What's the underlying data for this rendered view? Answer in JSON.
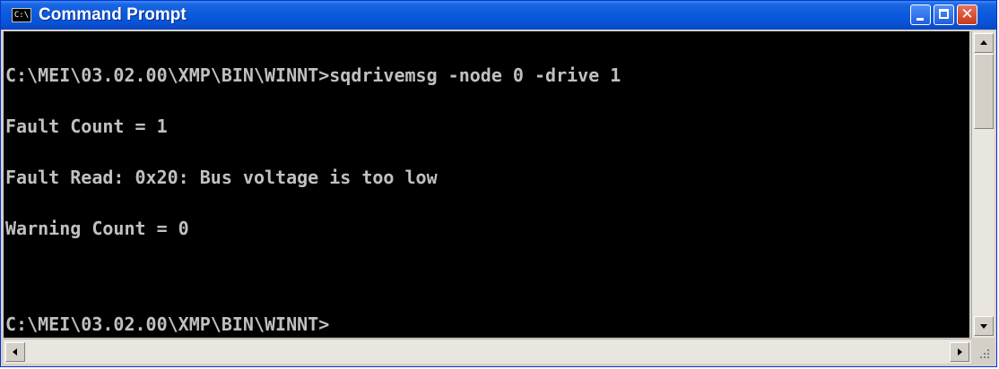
{
  "window": {
    "title": "Command Prompt",
    "icon": "console-app-icon",
    "icon_text": "C:\\",
    "controls": {
      "minimize_icon": "minimize-icon",
      "maximize_icon": "maximize-icon",
      "close_icon": "close-icon",
      "close_glyph": "✕"
    }
  },
  "console": {
    "lines": [
      "C:\\MEI\\03.02.00\\XMP\\BIN\\WINNT>sqdrivemsg -node 0 -drive 1",
      "Fault Count = 1",
      "Fault Read: 0x20: Bus voltage is too low",
      "Warning Count = 0",
      "",
      "C:\\MEI\\03.02.00\\XMP\\BIN\\WINNT>"
    ]
  },
  "colors": {
    "titlebar": "#0852d4",
    "console_bg": "#000000",
    "console_text": "#c0c0c0",
    "close_button": "#c8391b"
  }
}
